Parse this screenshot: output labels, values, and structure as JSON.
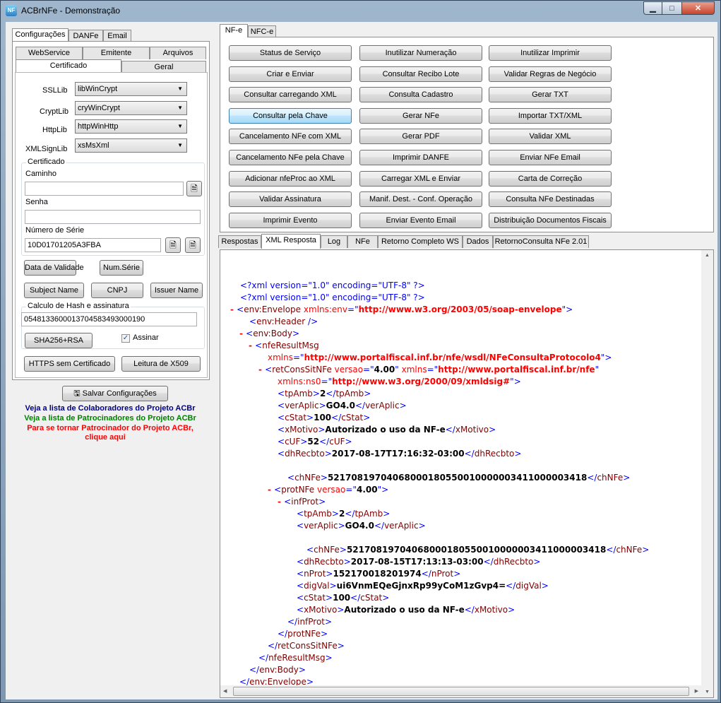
{
  "window": {
    "title": "ACBrNFe - Demonstração",
    "min": "▁",
    "max": "□",
    "close": "✕"
  },
  "left": {
    "top_tabs": [
      "Configurações",
      "DANFe",
      "Email"
    ],
    "sub_tabs_row1": [
      "WebService",
      "Emitente",
      "Arquivos"
    ],
    "sub_tabs_row2": [
      "Certificado",
      "Geral"
    ],
    "ssl": {
      "label": "SSLLib",
      "value": "libWinCrypt"
    },
    "crypt": {
      "label": "CryptLib",
      "value": "cryWinCrypt"
    },
    "http": {
      "label": "HttpLib",
      "value": "httpWinHttp"
    },
    "xmlsign": {
      "label": "XMLSignLib",
      "value": "xsMsXml"
    },
    "cert_group": "Certificado",
    "caminho_label": "Caminho",
    "caminho_value": "",
    "senha_label": "Senha",
    "senha_value": "",
    "serie_label": "Número de Série",
    "serie_value": "10D01701205A3FBA",
    "btn_validade": "Data de Validade",
    "btn_numserie": "Num.Série",
    "btn_subject": "Subject Name",
    "btn_cnpj": "CNPJ",
    "btn_issuer": "Issuer Name",
    "hash_group": "Calculo de Hash e assinatura",
    "hash_value": "05481336000137045834930001​90",
    "btn_sha": "SHA256+RSA",
    "assinar_label": "Assinar",
    "btn_https": "HTTPS sem Certificado",
    "btn_x509": "Leitura de X509",
    "btn_salvar": "Salvar Configurações",
    "link_colab": "Veja a lista de Colaboradores do Projeto ACBr",
    "link_patroc": "Veja a lista de Patrocinadores do Projeto ACBr",
    "link_tornar1": "Para se tornar Patrocinador do Projeto ACBr,",
    "link_tornar2": "clique aqui",
    "colors": {
      "colab": "#000080",
      "patroc": "#008000",
      "tornar": "#ff0000"
    }
  },
  "right": {
    "top_tabs": [
      "NF-e",
      "NFC-e"
    ],
    "buttons": [
      [
        "Status de Serviço",
        "Inutilizar Numeração",
        "Inutilizar Imprimir"
      ],
      [
        "Criar e Enviar",
        "Consultar Recibo Lote",
        "Validar Regras de Negócio"
      ],
      [
        "Consultar carregando XML",
        "Consulta Cadastro",
        "Gerar TXT"
      ],
      [
        "Consultar pela Chave",
        "Gerar NFe",
        "Importar TXT/XML"
      ],
      [
        "Cancelamento NFe com XML",
        "Gerar PDF",
        "Validar XML"
      ],
      [
        "Cancelamento NFe pela Chave",
        "Imprimir DANFE",
        "Enviar NFe Email"
      ],
      [
        "Adicionar nfeProc ao XML",
        "Carregar XML e Enviar",
        "Carta de Correção"
      ],
      [
        "Validar Assinatura",
        "Manif. Dest. - Conf. Operação",
        "Consulta NFe Destinadas"
      ],
      [
        "Imprimir Evento",
        "Enviar Evento Email",
        "Distribuição Documentos Fiscais"
      ]
    ],
    "result_tabs": [
      "Respostas",
      "XML Resposta",
      "Log",
      "NFe",
      "Retorno Completo WS",
      "Dados",
      "RetornoConsulta NFe 2.01"
    ],
    "xml": {
      "l1": "<?xml version=\"1.0\" encoding=\"UTF-8\" ?>",
      "l2": "<?xml version=\"1.0\" encoding=\"UTF-8\" ?>",
      "envelope_ns": "http://www.w3.org/2003/05/soap-envelope",
      "nfeResult_ns": "http://www.portalfiscal.inf.br/nfe/wsdl/NFeConsultaProtocolo4",
      "retCons_versao": "4.00",
      "retCons_ns": "http://www.portalfiscal.inf.br/nfe",
      "ns0": "http://www.w3.org/2000/09/xmldsig#",
      "tpAmb": "2",
      "verAplic": "GO4.0",
      "cStat": "100",
      "xMotivo": "Autorizado o uso da NF-e",
      "cUF": "52",
      "dhRecbto": "2017-08-17T17:16:32-03:00",
      "chNFe": "52170819704068000180550010000003411000003418",
      "prot_versao": "4.00",
      "prot_tpAmb": "2",
      "prot_verAplic": "GO4.0",
      "prot_chNFe": "52170819704068000180550010000003411000003418",
      "prot_dhRecbto": "2017-08-15T17:13:13-03:00",
      "nProt": "152170018201974",
      "digVal": "ui6VnmEQeGjnxRp99yCoM1zGvp4=",
      "prot_cStat": "100",
      "prot_xMotivo": "Autorizado o uso da NF-e"
    }
  }
}
